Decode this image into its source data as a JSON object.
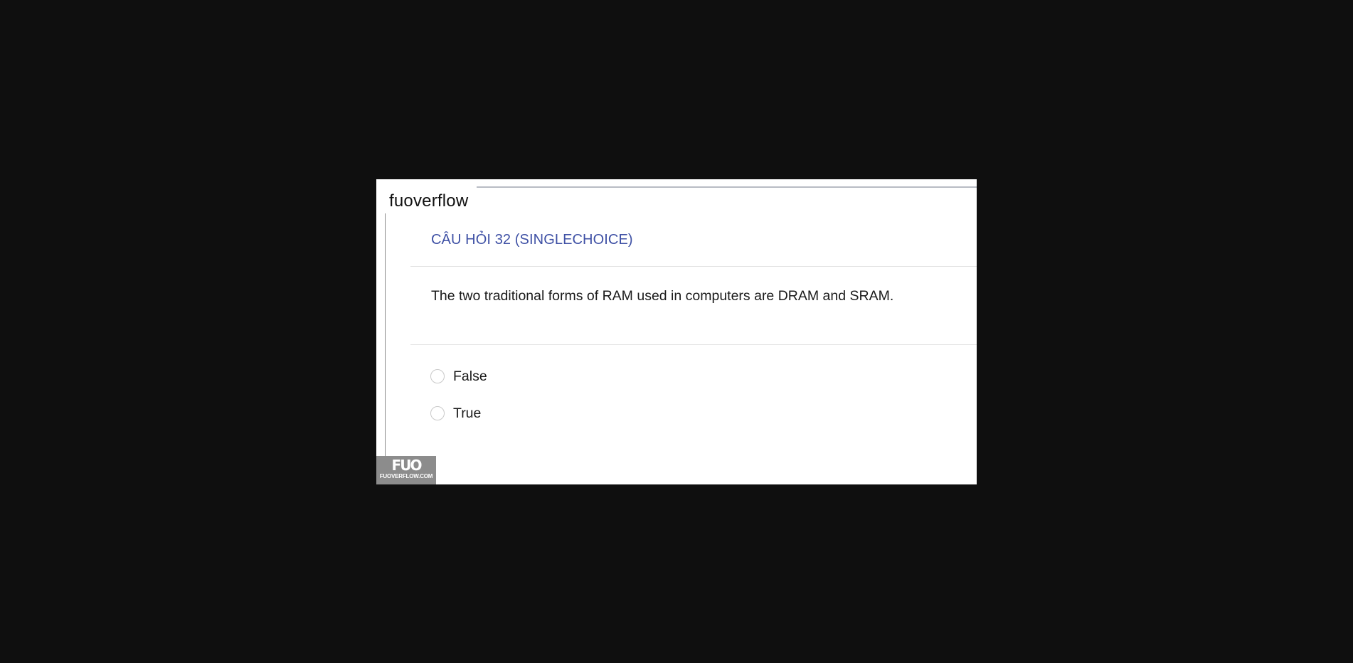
{
  "site": {
    "name": "fuoverflow"
  },
  "question": {
    "title": "CÂU HỎI 32 (SINGLECHOICE)",
    "text": "The two traditional forms of RAM used in computers are DRAM and SRAM."
  },
  "options": [
    {
      "label": "False",
      "selected": false
    },
    {
      "label": "True",
      "selected": false
    }
  ],
  "watermark": {
    "logo": "FUO",
    "domain": "FUOVERFLOW.COM"
  },
  "colors": {
    "background": "#0f0f0f",
    "title_accent": "#3f51a5",
    "text": "#1a1a1a"
  }
}
